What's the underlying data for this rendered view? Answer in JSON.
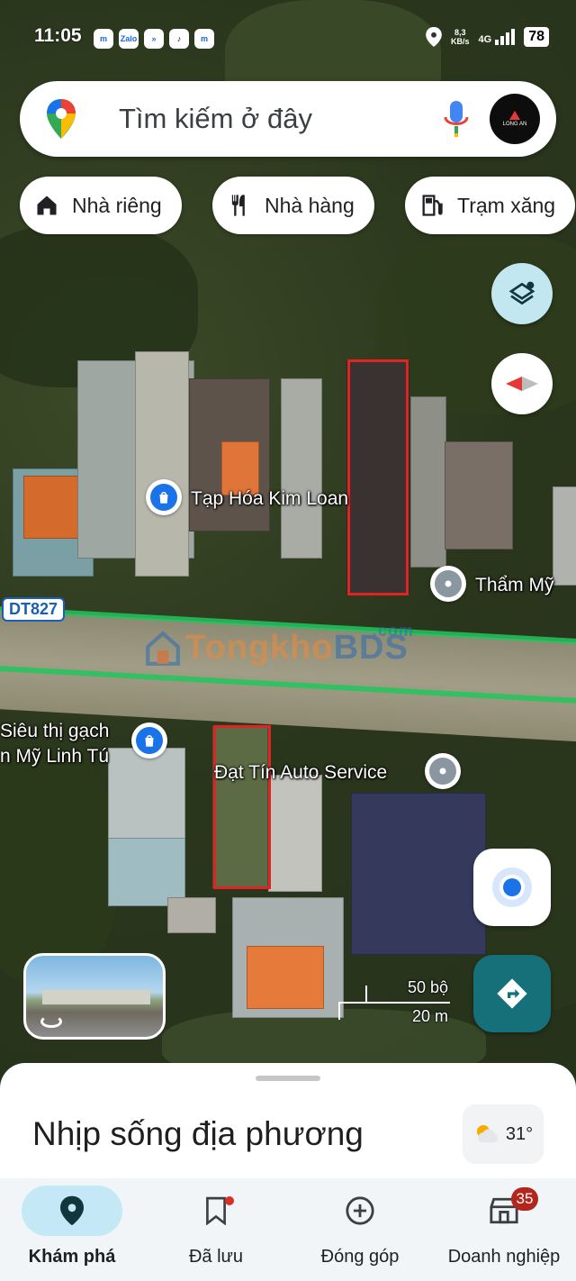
{
  "status_bar": {
    "time": "11:05",
    "app_icons": [
      "messenger-icon",
      "zalo-icon",
      "app-icon",
      "tiktok-icon",
      "messenger-icon"
    ],
    "net_speed": "8,3",
    "net_unit": "KB/s",
    "network": "4G",
    "battery": "78"
  },
  "search": {
    "placeholder": "Tìm kiếm ở đây",
    "avatar_text": "LONG AN"
  },
  "chips": [
    {
      "label": "Nhà riêng",
      "icon": "home-icon"
    },
    {
      "label": "Nhà hàng",
      "icon": "restaurant-icon"
    },
    {
      "label": "Trạm xăng",
      "icon": "gas-station-icon"
    }
  ],
  "map": {
    "road_label": "DT827",
    "watermark_left": "Tongkho",
    "watermark_right": "BDS",
    "watermark_com": ".com",
    "pois": [
      {
        "label": "Tạp Hóa Kim Loan",
        "icon": "shopping-bag-icon"
      },
      {
        "label": "Thẩm Mỹ",
        "icon": "place-icon"
      },
      {
        "label_line1": "Siêu thị gạch",
        "label_line2": "n Mỹ Linh Tú",
        "icon": "shopping-bag-icon"
      },
      {
        "label": "Đạt Tín Auto Service",
        "icon": "place-icon"
      }
    ],
    "scale_ft": "50 bộ",
    "scale_m": "20 m"
  },
  "sheet": {
    "title": "Nhịp sống địa phương",
    "weather_temp": "31°"
  },
  "nav": {
    "items": [
      {
        "label": "Khám phá",
        "icon": "explore-pin-icon",
        "active": true
      },
      {
        "label": "Đã lưu",
        "icon": "bookmark-icon"
      },
      {
        "label": "Đóng góp",
        "icon": "add-circle-icon"
      },
      {
        "label": "Doanh nghiệp",
        "icon": "store-icon",
        "badge": "35"
      }
    ]
  },
  "colors": {
    "highlight": "#e02424",
    "poi_blue": "#1a73e8",
    "road_line": "#22c55e",
    "directions": "#16707a"
  }
}
